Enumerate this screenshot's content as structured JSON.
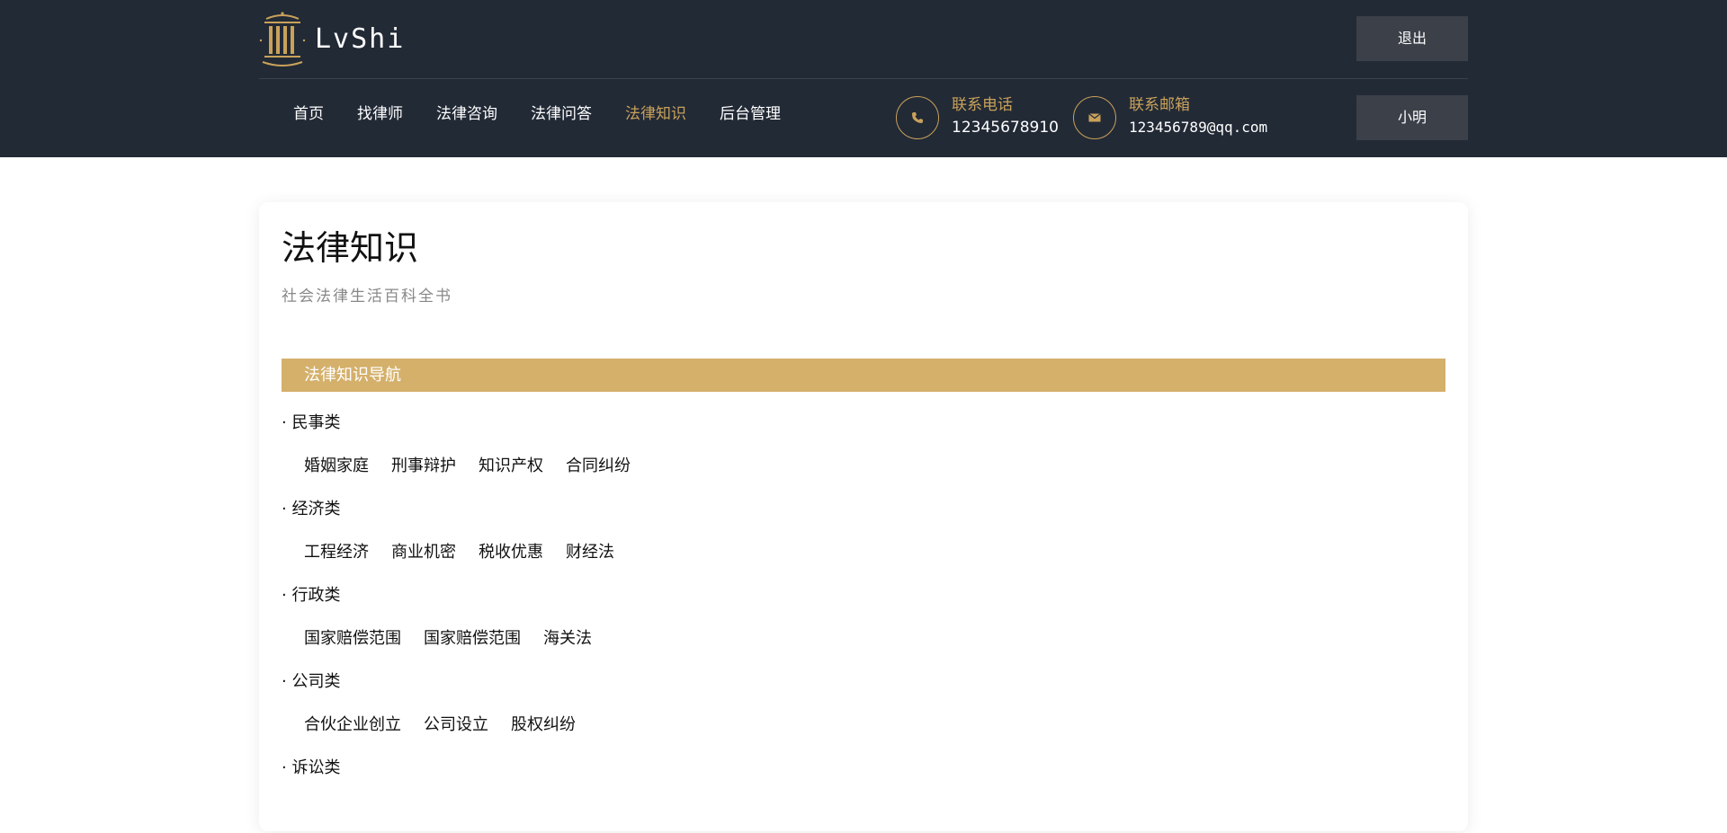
{
  "brand": {
    "name": "LvShi"
  },
  "header": {
    "logout_label": "退出",
    "user_label": "小明"
  },
  "nav": [
    {
      "label": "首页",
      "active": false
    },
    {
      "label": "找律师",
      "active": false
    },
    {
      "label": "法律咨询",
      "active": false
    },
    {
      "label": "法律问答",
      "active": false
    },
    {
      "label": "法律知识",
      "active": true
    },
    {
      "label": "后台管理",
      "active": false
    }
  ],
  "contact": {
    "phone_label": "联系电话",
    "phone_value": "12345678910",
    "phone_icon": "phone-icon",
    "email_label": "联系邮箱",
    "email_value": "123456789@qq.com",
    "email_icon": "mail-icon"
  },
  "colors": {
    "header_bg": "#222a36",
    "accent": "#c9a15a",
    "section_bar": "#d4b06b"
  },
  "page": {
    "title": "法律知识",
    "subtitle": "社会法律生活百科全书",
    "section_title": "法律知识导航"
  },
  "categories": [
    {
      "title": "· 民事类",
      "links": [
        "婚姻家庭",
        "刑事辩护",
        "知识产权",
        "合同纠纷"
      ]
    },
    {
      "title": "· 经济类",
      "links": [
        "工程经济",
        "商业机密",
        "税收优惠",
        "财经法"
      ]
    },
    {
      "title": "· 行政类",
      "links": [
        "国家赔偿范围",
        "国家赔偿范围",
        "海关法"
      ]
    },
    {
      "title": "· 公司类",
      "links": [
        "合伙企业创立",
        "公司设立",
        "股权纠纷"
      ]
    },
    {
      "title": "· 诉讼类",
      "links": []
    }
  ]
}
